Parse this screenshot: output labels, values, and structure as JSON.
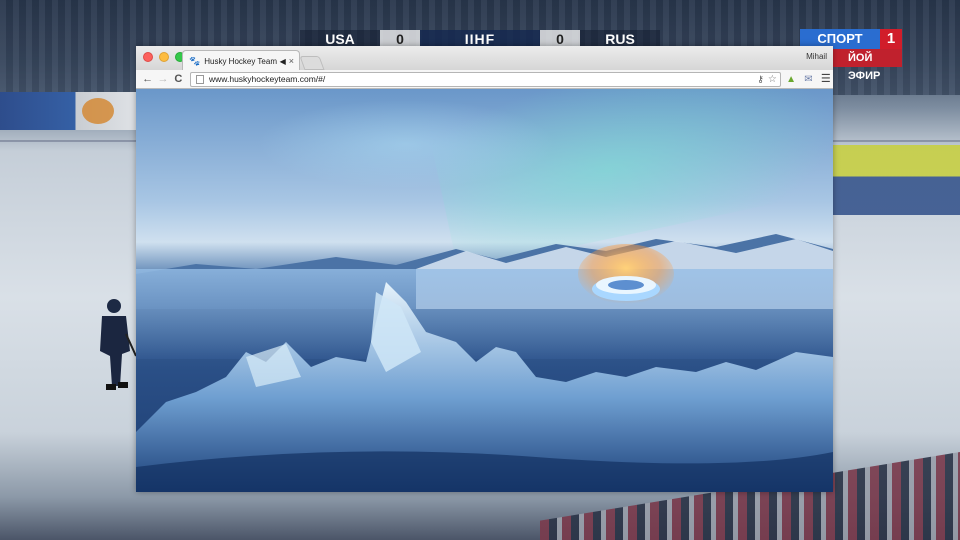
{
  "broadcast": {
    "scorebug": {
      "team_left": "USA",
      "score_left": "0",
      "center": "IIHF",
      "score_right": "0",
      "team_right": "RUS"
    },
    "channel": {
      "name": "СПОРТ",
      "number": "1",
      "live": "ЙОЙ ЭФИР"
    }
  },
  "browser": {
    "tab": {
      "favicon": "paw-icon",
      "title": "Husky Hockey Team"
    },
    "user": "Mihail",
    "nav": {
      "back": "←",
      "forward": "→",
      "reload": "C"
    },
    "omnibox": {
      "url": "www.huskyhockeyteam.com/#/"
    },
    "extensions": [
      "key-icon",
      "star-icon",
      "android-icon",
      "mail-icon",
      "menu-icon"
    ]
  },
  "page": {
    "hero_description_colors": {
      "sky": "#6a97c9",
      "aurora": "#78e6d2",
      "ice": "#c9e3f5",
      "arena_glow": "#ffb347"
    }
  }
}
